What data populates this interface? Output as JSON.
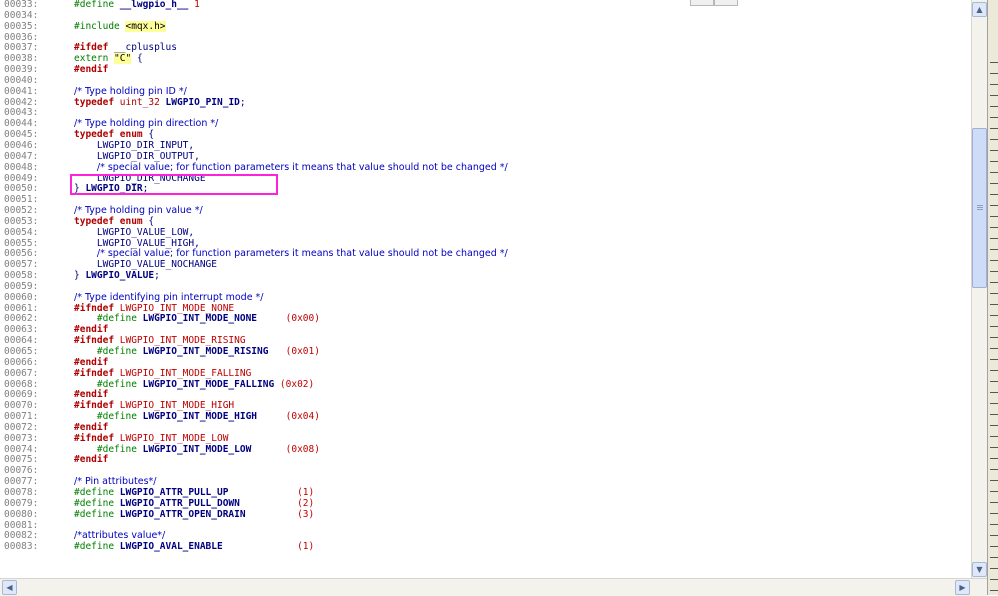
{
  "lines": [
    {
      "n": "00033:",
      "parts": [
        {
          "c": "pp",
          "t": "#define "
        },
        {
          "c": "id",
          "t": "__lwgpio_h__"
        },
        {
          "c": "mac",
          "t": " 1"
        }
      ]
    },
    {
      "n": "00034:",
      "parts": []
    },
    {
      "n": "00035:",
      "parts": [
        {
          "c": "pp",
          "t": "#include "
        },
        {
          "c": "str",
          "t": "<mqx.h>"
        }
      ]
    },
    {
      "n": "00036:",
      "parts": []
    },
    {
      "n": "00037:",
      "parts": [
        {
          "c": "kw",
          "t": "#ifdef"
        },
        {
          "c": "sym",
          "t": " __cplusplus"
        }
      ]
    },
    {
      "n": "00038:",
      "parts": [
        {
          "c": "pp",
          "t": "extern "
        },
        {
          "c": "str",
          "t": "\"C\""
        },
        {
          "c": "sym",
          "t": " {"
        }
      ]
    },
    {
      "n": "00039:",
      "parts": [
        {
          "c": "kw",
          "t": "#endif"
        }
      ]
    },
    {
      "n": "00040:",
      "parts": []
    },
    {
      "n": "00041:",
      "parts": [
        {
          "c": "cm",
          "t": "/* Type holding pin ID */"
        }
      ]
    },
    {
      "n": "00042:",
      "parts": [
        {
          "c": "kw",
          "t": "typedef"
        },
        {
          "c": "ty",
          "t": " uint_32 "
        },
        {
          "c": "id",
          "t": "LWGPIO_PIN_ID"
        },
        {
          "c": "sym",
          "t": ";"
        }
      ]
    },
    {
      "n": "00043:",
      "parts": []
    },
    {
      "n": "00044:",
      "parts": [
        {
          "c": "cm",
          "t": "/* Type holding pin direction */"
        }
      ]
    },
    {
      "n": "00045:",
      "parts": [
        {
          "c": "kw",
          "t": "typedef enum"
        },
        {
          "c": "sym",
          "t": " {"
        }
      ]
    },
    {
      "n": "00046:",
      "parts": [
        {
          "c": "sym",
          "t": "    LWGPIO_DIR_INPUT,"
        }
      ]
    },
    {
      "n": "00047:",
      "parts": [
        {
          "c": "sym",
          "t": "    LWGPIO_DIR_OUTPUT,"
        }
      ]
    },
    {
      "n": "00048:",
      "parts": [
        {
          "c": "sym",
          "t": "    "
        },
        {
          "c": "cm",
          "t": "/* special value; for function parameters it means that value should not be changed */"
        }
      ]
    },
    {
      "n": "00049:",
      "parts": [
        {
          "c": "sym",
          "t": "    LWGPIO_DIR_NOCHANGE"
        }
      ]
    },
    {
      "n": "00050:",
      "parts": [
        {
          "c": "sym",
          "t": "} "
        },
        {
          "c": "id",
          "t": "LWGPIO_DIR"
        },
        {
          "c": "sym",
          "t": ";"
        }
      ]
    },
    {
      "n": "00051:",
      "parts": []
    },
    {
      "n": "00052:",
      "parts": [
        {
          "c": "cm",
          "t": "/* Type holding pin value */"
        }
      ]
    },
    {
      "n": "00053:",
      "parts": [
        {
          "c": "kw",
          "t": "typedef enum"
        },
        {
          "c": "sym",
          "t": " {"
        }
      ]
    },
    {
      "n": "00054:",
      "parts": [
        {
          "c": "sym",
          "t": "    LWGPIO_VALUE_LOW,"
        }
      ]
    },
    {
      "n": "00055:",
      "parts": [
        {
          "c": "sym",
          "t": "    LWGPIO_VALUE_HIGH,"
        }
      ]
    },
    {
      "n": "00056:",
      "parts": [
        {
          "c": "sym",
          "t": "    "
        },
        {
          "c": "cm",
          "t": "/* special value; for function parameters it means that value should not be changed */"
        }
      ]
    },
    {
      "n": "00057:",
      "parts": [
        {
          "c": "sym",
          "t": "    LWGPIO_VALUE_NOCHANGE"
        }
      ]
    },
    {
      "n": "00058:",
      "parts": [
        {
          "c": "sym",
          "t": "} "
        },
        {
          "c": "id",
          "t": "LWGPIO_VALUE"
        },
        {
          "c": "sym",
          "t": ";"
        }
      ]
    },
    {
      "n": "00059:",
      "parts": []
    },
    {
      "n": "00060:",
      "parts": [
        {
          "c": "cm",
          "t": "/* Type identifying pin interrupt mode */"
        }
      ]
    },
    {
      "n": "00061:",
      "parts": [
        {
          "c": "kw",
          "t": "#ifndef"
        },
        {
          "c": "mac",
          "t": " LWGPIO_INT_MODE_NONE"
        }
      ]
    },
    {
      "n": "00062:",
      "parts": [
        {
          "c": "pp",
          "t": "    #define "
        },
        {
          "c": "id",
          "t": "LWGPIO_INT_MODE_NONE    "
        },
        {
          "c": "num",
          "t": " (0x00)"
        }
      ]
    },
    {
      "n": "00063:",
      "parts": [
        {
          "c": "kw",
          "t": "#endif"
        }
      ]
    },
    {
      "n": "00064:",
      "parts": [
        {
          "c": "kw",
          "t": "#ifndef"
        },
        {
          "c": "mac",
          "t": " LWGPIO_INT_MODE_RISING"
        }
      ]
    },
    {
      "n": "00065:",
      "parts": [
        {
          "c": "pp",
          "t": "    #define "
        },
        {
          "c": "id",
          "t": "LWGPIO_INT_MODE_RISING  "
        },
        {
          "c": "num",
          "t": " (0x01)"
        }
      ]
    },
    {
      "n": "00066:",
      "parts": [
        {
          "c": "kw",
          "t": "#endif"
        }
      ]
    },
    {
      "n": "00067:",
      "parts": [
        {
          "c": "kw",
          "t": "#ifndef"
        },
        {
          "c": "mac",
          "t": " LWGPIO_INT_MODE_FALLING"
        }
      ]
    },
    {
      "n": "00068:",
      "parts": [
        {
          "c": "pp",
          "t": "    #define "
        },
        {
          "c": "id",
          "t": "LWGPIO_INT_MODE_FALLING "
        },
        {
          "c": "num",
          "t": "(0x02)"
        }
      ]
    },
    {
      "n": "00069:",
      "parts": [
        {
          "c": "kw",
          "t": "#endif"
        }
      ]
    },
    {
      "n": "00070:",
      "parts": [
        {
          "c": "kw",
          "t": "#ifndef"
        },
        {
          "c": "mac",
          "t": " LWGPIO_INT_MODE_HIGH"
        }
      ]
    },
    {
      "n": "00071:",
      "parts": [
        {
          "c": "pp",
          "t": "    #define "
        },
        {
          "c": "id",
          "t": "LWGPIO_INT_MODE_HIGH    "
        },
        {
          "c": "num",
          "t": " (0x04)"
        }
      ]
    },
    {
      "n": "00072:",
      "parts": [
        {
          "c": "kw",
          "t": "#endif"
        }
      ]
    },
    {
      "n": "00073:",
      "parts": [
        {
          "c": "kw",
          "t": "#ifndef"
        },
        {
          "c": "mac",
          "t": " LWGPIO_INT_MODE_LOW"
        }
      ]
    },
    {
      "n": "00074:",
      "parts": [
        {
          "c": "pp",
          "t": "    #define "
        },
        {
          "c": "id",
          "t": "LWGPIO_INT_MODE_LOW     "
        },
        {
          "c": "num",
          "t": " (0x08)"
        }
      ]
    },
    {
      "n": "00075:",
      "parts": [
        {
          "c": "kw",
          "t": "#endif"
        }
      ]
    },
    {
      "n": "00076:",
      "parts": []
    },
    {
      "n": "00077:",
      "parts": [
        {
          "c": "cm",
          "t": "/* Pin attributes*/"
        }
      ]
    },
    {
      "n": "00078:",
      "parts": [
        {
          "c": "pp",
          "t": "#define "
        },
        {
          "c": "id",
          "t": "LWGPIO_ATTR_PULL_UP       "
        },
        {
          "c": "num",
          "t": "     (1)"
        }
      ]
    },
    {
      "n": "00079:",
      "parts": [
        {
          "c": "pp",
          "t": "#define "
        },
        {
          "c": "id",
          "t": "LWGPIO_ATTR_PULL_DOWN     "
        },
        {
          "c": "num",
          "t": "     (2)"
        }
      ]
    },
    {
      "n": "00080:",
      "parts": [
        {
          "c": "pp",
          "t": "#define "
        },
        {
          "c": "id",
          "t": "LWGPIO_ATTR_OPEN_DRAIN    "
        },
        {
          "c": "num",
          "t": "     (3)"
        }
      ]
    },
    {
      "n": "00081:",
      "parts": []
    },
    {
      "n": "00082:",
      "parts": [
        {
          "c": "cm",
          "t": "/*attributes value*/"
        }
      ]
    },
    {
      "n": "00083:",
      "parts": [
        {
          "c": "pp",
          "t": "#define "
        },
        {
          "c": "id",
          "t": "LWGPIO_AVAL_ENABLE        "
        },
        {
          "c": "num",
          "t": "     (1)"
        }
      ]
    }
  ],
  "colors": {
    "highlight_box": "#ff22dd"
  },
  "icons": {
    "scroll_up": "triangle-up-icon",
    "scroll_down": "triangle-down-icon",
    "scroll_left": "triangle-left-icon",
    "scroll_right": "triangle-right-icon"
  }
}
